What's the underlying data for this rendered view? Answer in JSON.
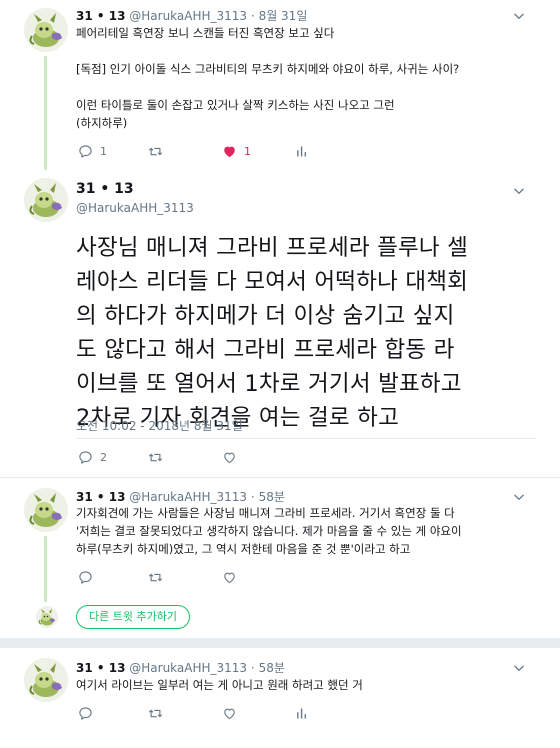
{
  "tweets": [
    {
      "name": "31 • 13",
      "handle": "@HarukaAHH_3113",
      "sep": "·",
      "time": "8월 31일",
      "lines": [
        "페어리테일 흑연장 보니 스캔들 터진 흑연장 보고 싶다",
        "",
        "[독점] 인기 아이돌 식스 그라비티의 무츠키 하지메와 야요이 하루, 사귀는 사이?",
        "",
        "이런 타이틀로 둘이 손잡고 있거나 살짝 키스하는 사진 나오고 그런",
        "(하지하루)"
      ],
      "replies": "1",
      "retweets": "",
      "likes": "1"
    },
    {
      "name": "31 • 13",
      "handle": "@HarukaAHH_3113",
      "lines": [
        "사장님 매니져 그라비 프로세라 플루나 셀",
        "레아스 리더들 다 모여서 어떡하나 대책회",
        "의 하다가 하지메가 더 이상 숨기고 싶지",
        "도 않다고 해서 그라비 프로세라 합동 라",
        "이브를 또 열어서 1차로 거기서 발표하고",
        "2차로 기자 회견을 여는 걸로 하고"
      ],
      "timestamp": "오전 10:02 - 2018년 8월 31일",
      "replies": "2",
      "retweets": "",
      "likes": ""
    },
    {
      "name": "31 • 13",
      "handle": "@HarukaAHH_3113",
      "sep": "·",
      "time": "58분",
      "lines": [
        "기자회견에 가는 사람들은 사장님 매니져 그라비 프로세라. 거기서 흑연장 둘 다",
        "'저희는 결코 잘못되었다고 생각하지 않습니다. 제가 마음을 줄 수 있는 게 야요이",
        "하루(무츠키 하지메)였고, 그 역시 저한테 마음을 준 것 뿐'이라고 하고"
      ],
      "replies": "",
      "retweets": "",
      "likes": ""
    },
    {
      "name": "31 • 13",
      "handle": "@HarukaAHH_3113",
      "sep": "·",
      "time": "58분",
      "lines": [
        "여기서 라이브는 일부러 여는 게 아니고 원래 하려고 했던 거"
      ],
      "replies": "",
      "retweets": "",
      "likes": ""
    }
  ],
  "more_button": "다른 트윗 추가하기",
  "colors": {
    "accent_green": "#17bf63",
    "like_red": "#e0245e",
    "muted": "#657786",
    "thread_line": "#cfe9c4"
  },
  "icons": [
    "reply-icon",
    "retweet-icon",
    "like-icon",
    "analytics-icon",
    "chevron-down-icon"
  ]
}
